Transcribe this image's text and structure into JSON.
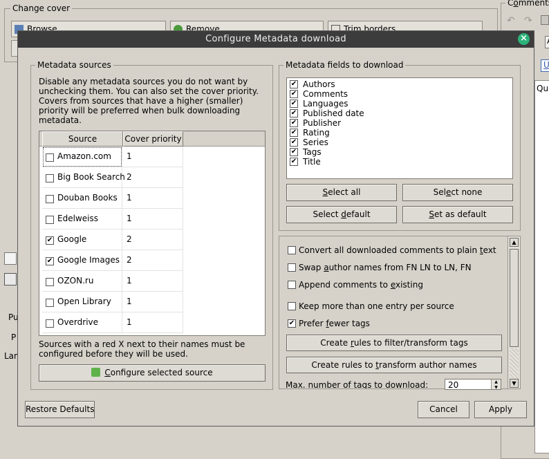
{
  "background": {
    "change_cover_title": "Change cover",
    "browse_label": "Browse",
    "remove_label": "Remove",
    "trim_label": "Trim borders",
    "comments_title": "Comments",
    "side_text_qui": "Qui",
    "side_text_pu": "Pu",
    "side_text_p": "P",
    "side_text_lan": "Lan",
    "side_text_u": "U",
    "side_text_a": "A"
  },
  "dialog": {
    "title": "Configure Metadata download",
    "sources": {
      "group_title": "Metadata sources",
      "description": "Disable any metadata sources you do not want by unchecking them. You can also set the cover priority. Covers from sources that have a higher (smaller) priority will be preferred when bulk downloading metadata.",
      "col_source": "Source",
      "col_priority": "Cover priority",
      "rows": [
        {
          "name": "Amazon.com",
          "priority": "1",
          "checked": false
        },
        {
          "name": "Big Book Search",
          "priority": "2",
          "checked": false
        },
        {
          "name": "Douban Books",
          "priority": "1",
          "checked": false
        },
        {
          "name": "Edelweiss",
          "priority": "1",
          "checked": false
        },
        {
          "name": "Google",
          "priority": "2",
          "checked": true
        },
        {
          "name": "Google Images",
          "priority": "2",
          "checked": true
        },
        {
          "name": "OZON.ru",
          "priority": "1",
          "checked": false
        },
        {
          "name": "Open Library",
          "priority": "1",
          "checked": false
        },
        {
          "name": "Overdrive",
          "priority": "1",
          "checked": false
        }
      ],
      "note": "Sources with a red X next to their names must be configured before they will be used.",
      "configure_pre": "",
      "configure_u": "C",
      "configure_post": "onfigure selected source"
    },
    "fields": {
      "group_title": "Metadata fields to download",
      "items": [
        {
          "label": "Authors",
          "checked": true
        },
        {
          "label": "Comments",
          "checked": true
        },
        {
          "label": "Languages",
          "checked": true
        },
        {
          "label": "Published date",
          "checked": true
        },
        {
          "label": "Publisher",
          "checked": true
        },
        {
          "label": "Rating",
          "checked": true
        },
        {
          "label": "Series",
          "checked": true
        },
        {
          "label": "Tags",
          "checked": true
        },
        {
          "label": "Title",
          "checked": true
        }
      ],
      "select_all": {
        "pre": "",
        "u": "S",
        "post": "elect all"
      },
      "select_none": {
        "pre": "Sel",
        "u": "e",
        "post": "ct none"
      },
      "select_default": {
        "pre": "Select ",
        "u": "d",
        "post": "efault"
      },
      "set_as_default": {
        "pre": "",
        "u": "S",
        "post": "et as default"
      }
    },
    "options": {
      "convert_comments": {
        "pre": "Convert all downloaded comments to plain ",
        "u": "t",
        "post": "ext",
        "checked": false
      },
      "swap_authors": {
        "pre": "Swap ",
        "u": "a",
        "post": "uthor names from FN LN to LN, FN",
        "checked": false
      },
      "append_comments": {
        "pre": "Append comments to ",
        "u": "e",
        "post": "xisting",
        "checked": false
      },
      "keep_multiple": {
        "pre": "Keep more than one entry per source",
        "u": "",
        "post": "",
        "checked": false
      },
      "prefer_fewer_tags": {
        "pre": "Prefer ",
        "u": "f",
        "post": "ewer tags",
        "checked": true
      },
      "rules_tags": {
        "pre": "Create ",
        "u": "r",
        "post": "ules to filter/transform tags"
      },
      "rules_authors": {
        "pre": "Create rules to ",
        "u": "t",
        "post": "ransform author names"
      },
      "max_tags": {
        "pre": "Max. ",
        "u": "n",
        "post": "umber of tags to download:"
      },
      "max_tags_value": "20"
    },
    "restore_defaults": "Restore Defaults",
    "cancel": "Cancel",
    "apply": "Apply"
  }
}
